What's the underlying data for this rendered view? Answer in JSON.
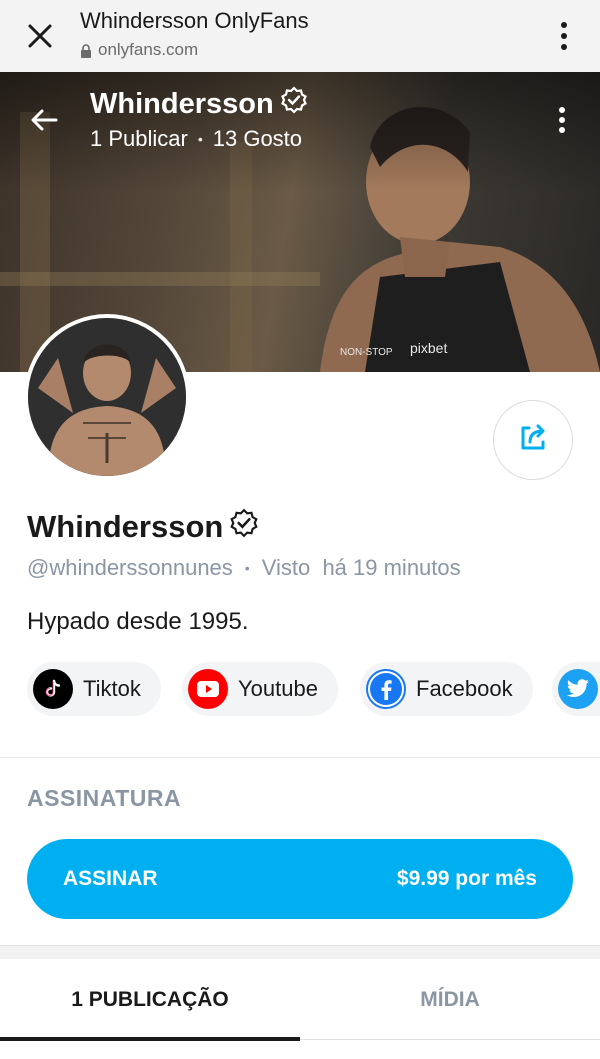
{
  "browser": {
    "title": "Whindersson OnlyFans",
    "url": "onlyfans.com"
  },
  "cover": {
    "name": "Whindersson",
    "posts": "1 Publicar",
    "likes": "13 Gosto"
  },
  "profile": {
    "name": "Whindersson",
    "handle": "@whinderssonnunes",
    "last_seen": "Visto  há 19 minutos",
    "bio": "Hypado desde 1995."
  },
  "socials": [
    {
      "label": "Tiktok",
      "icon": "tiktok-icon",
      "color": "#000000"
    },
    {
      "label": "Youtube",
      "icon": "youtube-icon",
      "color": "#ff0000"
    },
    {
      "label": "Facebook",
      "icon": "facebook-icon",
      "color": "#1877f2"
    },
    {
      "label": "",
      "icon": "twitter-icon",
      "color": "#1da1f2"
    }
  ],
  "subscription": {
    "section_title": "ASSINATURA",
    "button_label": "ASSINAR",
    "price": "$9.99 por mês"
  },
  "tabs": [
    {
      "label": "1 PUBLICAÇÃO",
      "active": true
    },
    {
      "label": "MÍDIA",
      "active": false
    }
  ],
  "colors": {
    "accent": "#00aff0",
    "muted": "#8a96a3"
  }
}
